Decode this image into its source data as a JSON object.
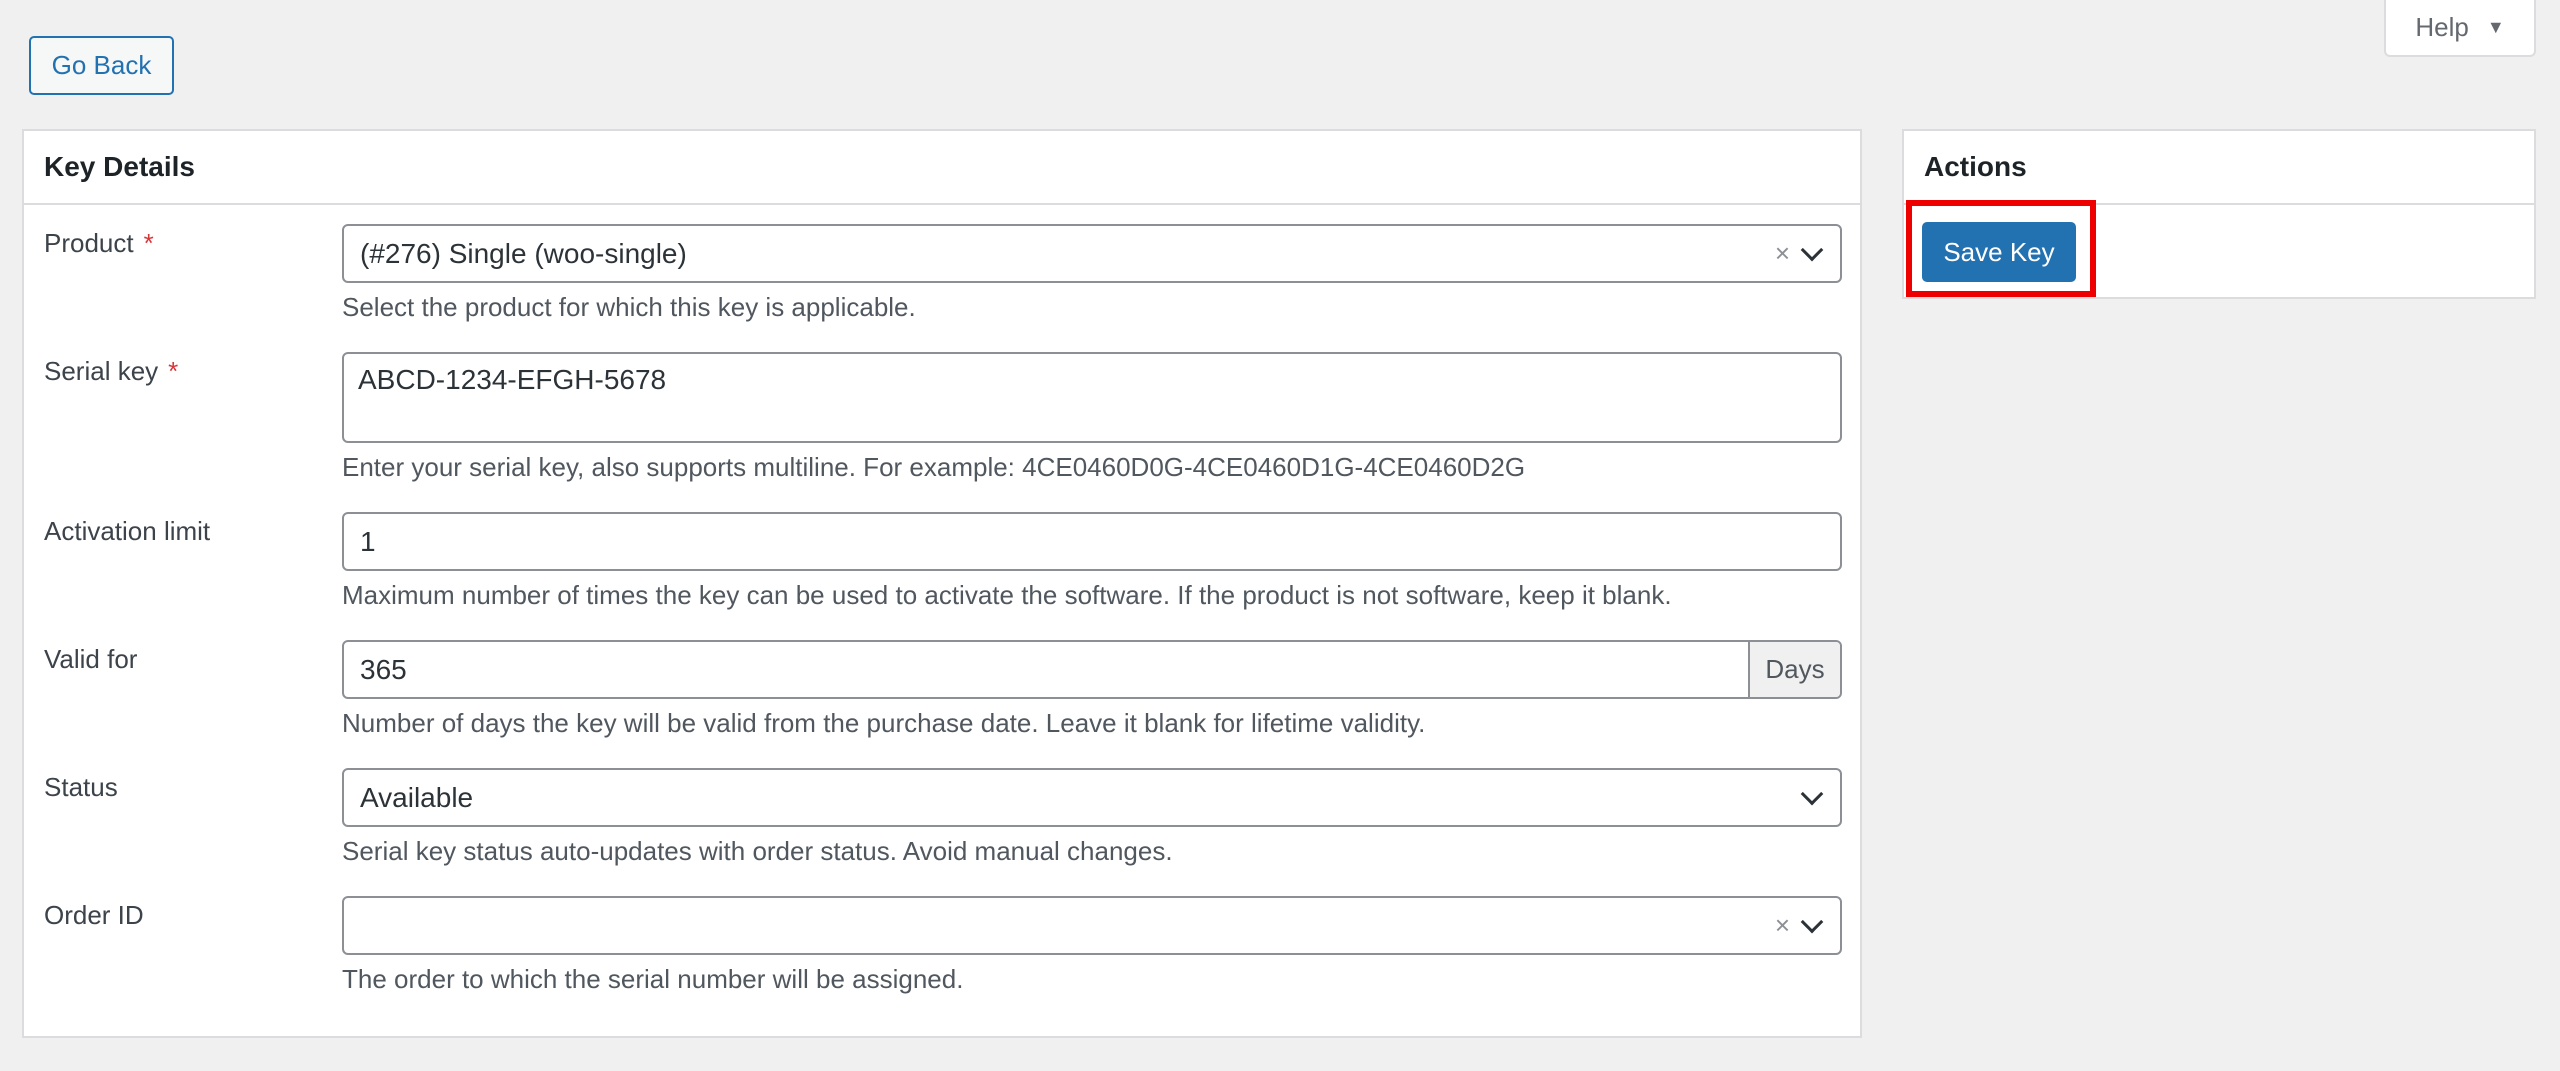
{
  "nav": {
    "go_back_label": "Go Back",
    "help_label": "Help",
    "help_arrow": "▼"
  },
  "key_details": {
    "title": "Key Details",
    "required_marker": "*",
    "product": {
      "label": "Product",
      "value": "(#276) Single (woo-single)",
      "description": "Select the product for which this key is applicable."
    },
    "serial_key": {
      "label": "Serial key",
      "value": "ABCD-1234-EFGH-5678",
      "description": "Enter your serial key, also supports multiline. For example: 4CE0460D0G-4CE0460D1G-4CE0460D2G"
    },
    "activation_limit": {
      "label": "Activation limit",
      "value": "1",
      "description": "Maximum number of times the key can be used to activate the software. If the product is not software, keep it blank."
    },
    "valid_for": {
      "label": "Valid for",
      "value": "365",
      "unit": "Days",
      "description": "Number of days the key will be valid from the purchase date. Leave it blank for lifetime validity."
    },
    "status": {
      "label": "Status",
      "value": "Available",
      "description": "Serial key status auto-updates with order status. Avoid manual changes."
    },
    "order_id": {
      "label": "Order ID",
      "value": "",
      "description": "The order to which the serial number will be assigned."
    },
    "clear_glyph": "×"
  },
  "actions": {
    "title": "Actions",
    "save_label": "Save Key"
  },
  "colors": {
    "accent": "#2271b1",
    "highlight": "#ee0000",
    "required": "#d63638"
  }
}
